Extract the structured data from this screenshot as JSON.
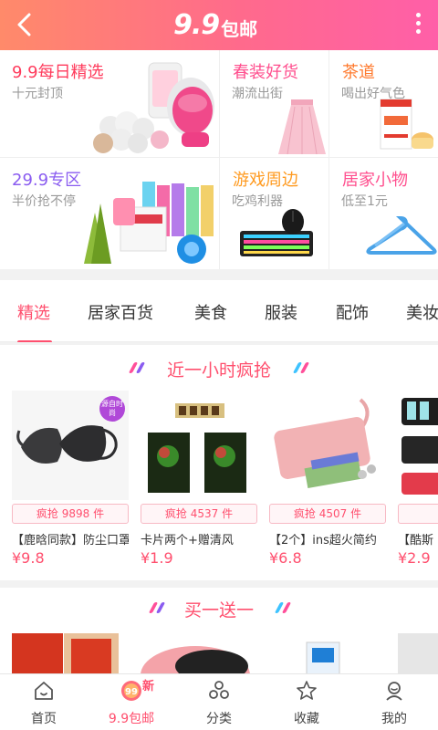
{
  "header": {
    "logo_number": "9.9",
    "logo_text": "包邮"
  },
  "promos": [
    {
      "title": "9.9每日精选",
      "subtitle": "十元封顶",
      "color": "#ff3b5c"
    },
    {
      "title": "春装好货",
      "subtitle": "潮流出街",
      "color": "#ff4f8e"
    },
    {
      "title": "茶道",
      "subtitle": "喝出好气色",
      "color": "#ff7a2e"
    },
    {
      "title": "29.9专区",
      "subtitle": "半价抢不停",
      "color": "#8a5cf0"
    },
    {
      "title": "游戏周边",
      "subtitle": "吃鸡利器",
      "color": "#ff9a1f"
    },
    {
      "title": "居家小物",
      "subtitle": "低至1元",
      "color": "#ff4f8e"
    }
  ],
  "tabs": [
    "精选",
    "居家百货",
    "美食",
    "服装",
    "配饰",
    "美妆"
  ],
  "active_tab": "精选",
  "flash_section": {
    "title": "近一小时疯抢"
  },
  "products": [
    {
      "sold": "疯抢 9898 件",
      "name": "【鹿晗同款】防尘口罩",
      "price": "¥9.8",
      "badge": "源自时尚"
    },
    {
      "sold": "疯抢 4537 件",
      "name": "卡片两个+赠清风",
      "price": "¥1.9"
    },
    {
      "sold": "疯抢 4507 件",
      "name": "【2个】ins超火简约",
      "price": "¥6.8"
    },
    {
      "sold": "疯抢",
      "name": "【酷斯",
      "price": "¥2.9"
    }
  ],
  "bogo_section": {
    "title": "买一送一"
  },
  "nav": {
    "items": [
      {
        "label": "首页",
        "icon": "home-icon"
      },
      {
        "label": "9.9包邮",
        "icon": "nine-nine-icon"
      },
      {
        "label": "分类",
        "icon": "category-icon"
      },
      {
        "label": "收藏",
        "icon": "star-icon"
      },
      {
        "label": "我的",
        "icon": "user-icon"
      }
    ],
    "active": "9.9包邮",
    "new_tag": "新"
  },
  "colors": {
    "brand": "#ff4f6e",
    "header_start": "#ff8a6a",
    "header_end": "#ff5fa8"
  }
}
